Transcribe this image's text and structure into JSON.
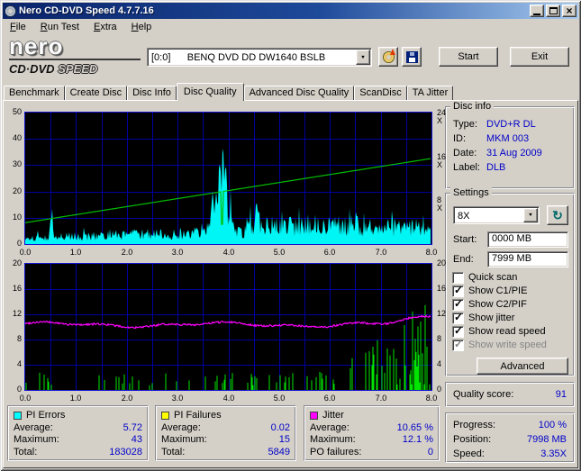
{
  "window": {
    "title": "Nero CD-DVD Speed 4.7.7.16"
  },
  "icons": {
    "close": "×",
    "dropdown_arrow": "▼",
    "refresh": "↻"
  },
  "menu": {
    "items": [
      "File",
      "Run Test",
      "Extra",
      "Help"
    ]
  },
  "logo": {
    "brand": "nero",
    "product_line1": "CD·DVD",
    "product_line2": "SPEED"
  },
  "toolbar": {
    "drive": "[0:0]      BENQ DVD DD DW1640 BSLB",
    "start_label": "Start",
    "exit_label": "Exit"
  },
  "tabs": {
    "items": [
      "Benchmark",
      "Create Disc",
      "Disc Info",
      "Disc Quality",
      "Advanced Disc Quality",
      "ScanDisc",
      "TA Jitter"
    ],
    "active": "Disc Quality",
    "active_index": 3
  },
  "disc_info": {
    "title": "Disc info",
    "rows": [
      {
        "label": "Type:",
        "value": "DVD+R DL"
      },
      {
        "label": "ID:",
        "value": "MKM 003"
      },
      {
        "label": "Date:",
        "value": "31 Aug 2009"
      },
      {
        "label": "Label:",
        "value": "DLB"
      }
    ]
  },
  "settings": {
    "title": "Settings",
    "speed_value": "8X",
    "start_label": "Start:",
    "start_value": "0000 MB",
    "end_label": "End:",
    "end_value": "7999 MB",
    "checkboxes": [
      {
        "label": "Quick scan",
        "checked": false,
        "disabled": false
      },
      {
        "label": "Show C1/PIE",
        "checked": true,
        "disabled": false
      },
      {
        "label": "Show C2/PIF",
        "checked": true,
        "disabled": false
      },
      {
        "label": "Show jitter",
        "checked": true,
        "disabled": false
      },
      {
        "label": "Show read speed",
        "checked": true,
        "disabled": false
      },
      {
        "label": "Show write speed",
        "checked": true,
        "disabled": true
      }
    ],
    "advanced_label": "Advanced"
  },
  "quality": {
    "label": "Quality score:",
    "value": "91"
  },
  "progress": {
    "rows": [
      {
        "label": "Progress:",
        "value": "100 %"
      },
      {
        "label": "Position:",
        "value": "7998 MB"
      },
      {
        "label": "Speed:",
        "value": "3.35X"
      }
    ]
  },
  "stats": {
    "pi_errors": {
      "name": "PI Errors",
      "color": "#00ffff",
      "rows": [
        {
          "label": "Average:",
          "value": "5.72"
        },
        {
          "label": "Maximum:",
          "value": "43"
        },
        {
          "label": "Total:",
          "value": "183028"
        }
      ]
    },
    "pi_failures": {
      "name": "PI Failures",
      "color": "#ffff00",
      "rows": [
        {
          "label": "Average:",
          "value": "0.02"
        },
        {
          "label": "Maximum:",
          "value": "15"
        },
        {
          "label": "Total:",
          "value": "5849"
        }
      ]
    },
    "jitter": {
      "name": "Jitter",
      "color": "#ff00ff",
      "rows": [
        {
          "label": "Average:",
          "value": "10.65 %"
        },
        {
          "label": "Maximum:",
          "value": "12.1 %"
        },
        {
          "label": "PO failures:",
          "value": "0"
        }
      ]
    }
  },
  "chart_data": [
    {
      "type": "area",
      "name": "PI Errors / Read speed",
      "bg": "#000000",
      "grid_color": "#0000a0",
      "border_color": "#1414d2",
      "x": {
        "range": [
          0,
          8
        ],
        "ticks": [
          "0.0",
          "1.0",
          "2.0",
          "3.0",
          "4.0",
          "5.0",
          "6.0",
          "7.0",
          "8.0"
        ],
        "minor_divisions": 16
      },
      "y_left": {
        "label": "PI Errors",
        "range": [
          0,
          50
        ],
        "ticks": [
          0,
          10,
          20,
          30,
          40,
          50
        ]
      },
      "y_right": {
        "label": "Speed",
        "range": [
          0,
          24
        ],
        "ticks": [
          8,
          16,
          24
        ],
        "suffix": "X"
      },
      "series": [
        {
          "name": "PI Errors",
          "style": "spiky-area",
          "color": "#00f5f5",
          "average": 5.72,
          "maximum": 43,
          "peak_x_gb": 3.9
        },
        {
          "name": "Read speed",
          "style": "line",
          "color": "#00c000",
          "start_speed_x": 3.9,
          "end_speed_x": 15.6,
          "dip_x_gb": 3.885
        }
      ]
    },
    {
      "type": "bar",
      "name": "PI Failures / Jitter",
      "bg": "#000000",
      "grid_color": "#0000a0",
      "border_color": "#1414d2",
      "x": {
        "range": [
          0,
          8
        ],
        "ticks": [
          "0.0",
          "1.0",
          "2.0",
          "3.0",
          "4.0",
          "5.0",
          "6.0",
          "7.0",
          "8.0"
        ],
        "minor_divisions": 16
      },
      "y_left": {
        "label": "PI Failures",
        "range": [
          0,
          20
        ],
        "ticks": [
          0,
          4,
          8,
          12,
          16,
          20
        ]
      },
      "y_right": {
        "label": "Jitter %",
        "range": [
          0,
          20
        ],
        "ticks": [
          0,
          4,
          8,
          12,
          16,
          20
        ]
      },
      "series": [
        {
          "name": "PI Failures",
          "style": "bars",
          "color": "#00e400",
          "average": 0.02,
          "maximum": 15
        },
        {
          "name": "Jitter",
          "style": "line",
          "color": "#ff00ff",
          "average": 10.65,
          "maximum": 12.1
        }
      ]
    }
  ]
}
